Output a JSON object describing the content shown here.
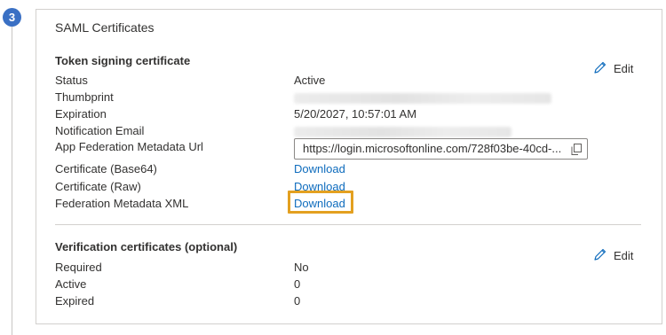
{
  "step": {
    "number": "3"
  },
  "card": {
    "title": "SAML Certificates"
  },
  "token_signing": {
    "title": "Token signing certificate",
    "edit_label": "Edit",
    "status": {
      "label": "Status",
      "value": "Active"
    },
    "thumbprint": {
      "label": "Thumbprint"
    },
    "expiration": {
      "label": "Expiration",
      "value": "5/20/2027, 10:57:01 AM"
    },
    "notification_email": {
      "label": "Notification Email"
    },
    "metadata_url": {
      "label": "App Federation Metadata Url",
      "value": "https://login.microsoftonline.com/728f03be-40cd-..."
    },
    "cert_base64": {
      "label": "Certificate (Base64)",
      "link": "Download"
    },
    "cert_raw": {
      "label": "Certificate (Raw)",
      "link": "Download"
    },
    "federation_xml": {
      "label": "Federation Metadata XML",
      "link": "Download"
    }
  },
  "verification": {
    "title": "Verification certificates (optional)",
    "edit_label": "Edit",
    "required": {
      "label": "Required",
      "value": "No"
    },
    "active": {
      "label": "Active",
      "value": "0"
    },
    "expired": {
      "label": "Expired",
      "value": "0"
    }
  },
  "colors": {
    "accent": "#3a70c4",
    "link": "#0f6cbd",
    "highlight": "#e3a020"
  },
  "icons": {
    "edit": "pencil-icon",
    "copy": "copy-icon"
  }
}
